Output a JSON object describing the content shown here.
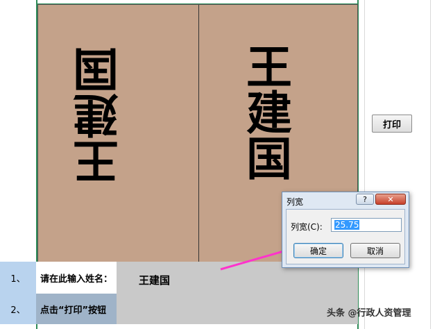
{
  "card": {
    "left_name": "王建国",
    "right_name": "王建国"
  },
  "rows": [
    {
      "num": "1、",
      "label": "请在此输入姓名：",
      "value": "王建国"
    },
    {
      "num": "2、",
      "label": "点击“打印”按钮",
      "value": ""
    }
  ],
  "print_button": {
    "label": "打印"
  },
  "dialog": {
    "title": "列宽",
    "help": "?",
    "close": "✕",
    "field_label": "列宽(C):",
    "field_value": "25.75",
    "ok": "确定",
    "cancel": "取消"
  },
  "colors": {
    "card_bg": "#c4a28a",
    "row_num_bg": "#b9d3ee",
    "gray_cell": "#c9c9c9",
    "arrow": "#ff33cc"
  },
  "watermark": "头条 @行政人资管理"
}
